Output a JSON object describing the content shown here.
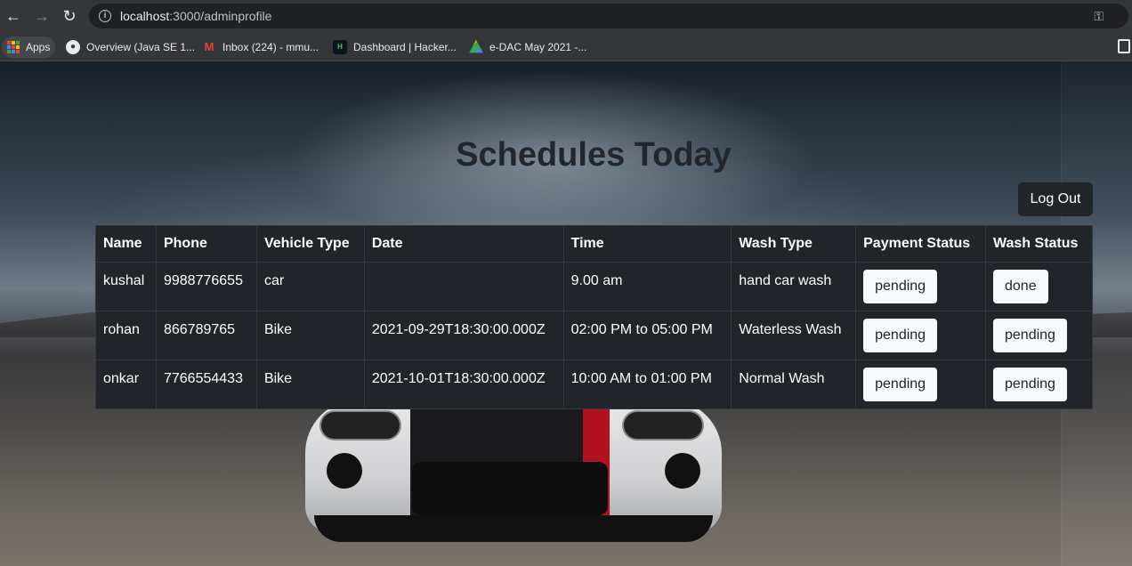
{
  "browser": {
    "url_host": "localhost",
    "url_rest": ":3000/adminprofile",
    "bookmarks": [
      {
        "label": "Apps",
        "icon": "apps-grid-icon"
      },
      {
        "label": "Overview (Java SE 1...",
        "icon": "globe-icon"
      },
      {
        "label": "Inbox (224) - mmu...",
        "icon": "gmail-icon"
      },
      {
        "label": "Dashboard | Hacker...",
        "icon": "hackerrank-icon"
      },
      {
        "label": "e-DAC May 2021 -...",
        "icon": "drive-icon"
      }
    ]
  },
  "page": {
    "heading": "Schedules Today",
    "logout_label": "Log Out"
  },
  "table": {
    "headers": [
      "Name",
      "Phone",
      "Vehicle Type",
      "Date",
      "Time",
      "Wash Type",
      "Payment Status",
      "Wash Status"
    ],
    "rows": [
      {
        "name": "kushal",
        "phone": "9988776655",
        "vehicle": "car",
        "date": "",
        "time": "9.00 am",
        "wash_type": "hand car wash",
        "payment_status": "pending",
        "wash_status": "done"
      },
      {
        "name": "rohan",
        "phone": "866789765",
        "vehicle": "Bike",
        "date": "2021-09-29T18:30:00.000Z",
        "time": "02:00 PM to 05:00 PM",
        "wash_type": "Waterless Wash",
        "payment_status": "pending",
        "wash_status": "pending"
      },
      {
        "name": "onkar",
        "phone": "7766554433",
        "vehicle": "Bike",
        "date": "2021-10-01T18:30:00.000Z",
        "time": "10:00 AM to 01:00 PM",
        "wash_type": "Normal Wash",
        "payment_status": "pending",
        "wash_status": "pending"
      }
    ]
  },
  "colors": {
    "table_bg": "#212529",
    "button_light": "#f8f9fa",
    "chrome_bg": "#35363a",
    "stripe_red": "#b01220"
  }
}
